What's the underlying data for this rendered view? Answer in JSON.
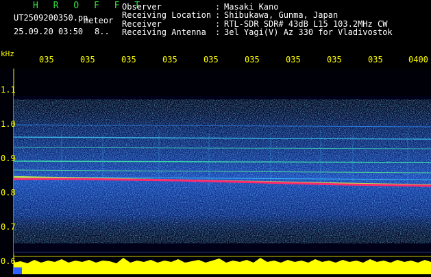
{
  "header": {
    "app_title": "H R O F F T",
    "filename": "UT2509200350.pn",
    "filename_tail": "meteor",
    "timestamp": "25.09.20 03:50",
    "count": "8..",
    "info": [
      {
        "label": "Observer",
        "sep": ":",
        "value": "Masaki Kano"
      },
      {
        "label": "Receiving Location",
        "sep": ":",
        "value": "Shibukawa, Gunma, Japan"
      },
      {
        "label": "Receiver",
        "sep": ":",
        "value": "RTL-SDR SDR# 43dB L15 103.2MHz CW"
      },
      {
        "label": "Receiving Antenna",
        "sep": ":",
        "value": "3el Yagi(V) Az 330 for Vladivostok"
      }
    ]
  },
  "axis": {
    "unit": "kHz",
    "time_ticks": [
      "035",
      "035",
      "035",
      "035",
      "035",
      "035",
      "035",
      "035",
      "035",
      "0400"
    ],
    "freq_ticks": [
      "1.1",
      "1.0",
      "0.9",
      "0.8",
      "0.7",
      "0.6"
    ]
  },
  "colors": {
    "background": "#000000",
    "title": "#33e040",
    "axis_text": "#ffff00",
    "signal_band": "#1e5cff",
    "meteor_trace": "#ff2a6e",
    "activity_bar": "#ffff00"
  }
}
